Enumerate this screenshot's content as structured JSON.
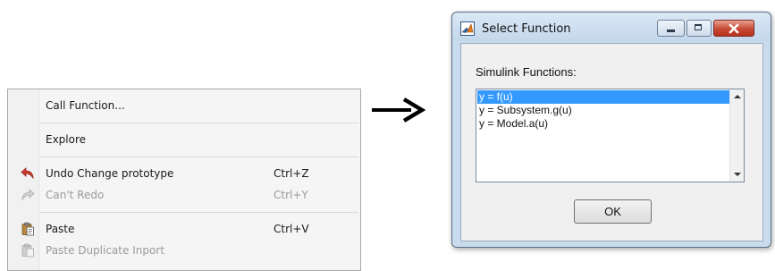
{
  "context_menu": {
    "items": [
      {
        "label": "Call Function...",
        "shortcut": "",
        "icon": "",
        "enabled": true
      },
      {
        "label": "Explore",
        "shortcut": "",
        "icon": "",
        "enabled": true
      },
      {
        "label": "Undo Change prototype",
        "shortcut": "Ctrl+Z",
        "icon": "undo-icon",
        "enabled": true
      },
      {
        "label": "Can't Redo",
        "shortcut": "Ctrl+Y",
        "icon": "redo-icon",
        "enabled": false
      },
      {
        "label": "Paste",
        "shortcut": "Ctrl+V",
        "icon": "paste-icon",
        "enabled": true
      },
      {
        "label": "Paste Duplicate Inport",
        "shortcut": "",
        "icon": "paste-icon",
        "enabled": false
      }
    ]
  },
  "arrow": {
    "icon": "right-arrow-icon"
  },
  "dialog": {
    "title": "Select Function",
    "app_icon": "matlab-icon",
    "section_label": "Simulink Functions:",
    "functions": [
      "y = f(u)",
      "y = Subsystem.g(u)",
      "y = Model.a(u)"
    ],
    "selected_index": 0,
    "ok_label": "OK"
  },
  "colors": {
    "selection": "#3399ff",
    "undo_icon": "#d23a2c",
    "close_button": "#c84a33",
    "dialog_frame": "#c9dcee"
  }
}
